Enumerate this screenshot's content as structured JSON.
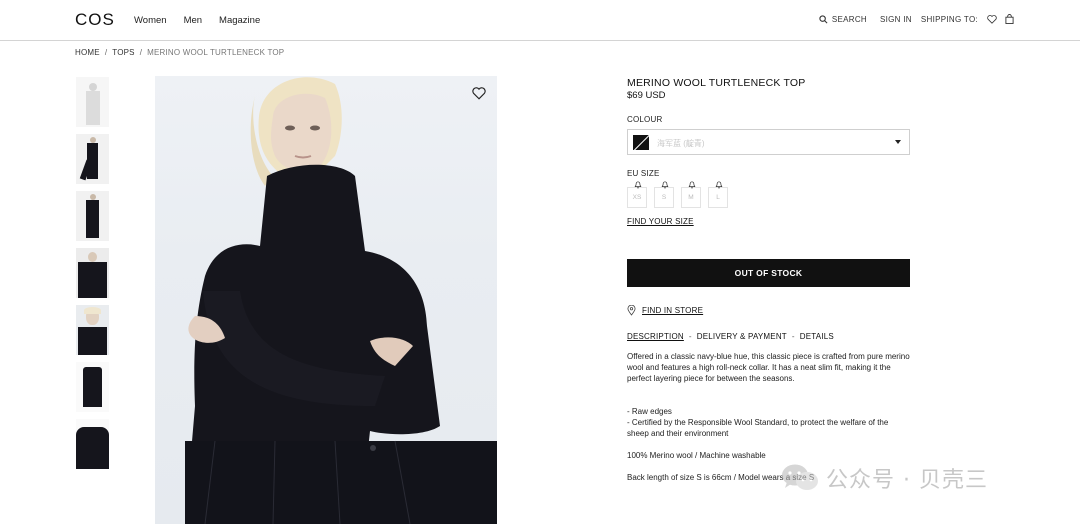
{
  "header": {
    "logo": "COS",
    "nav": [
      "Women",
      "Men",
      "Magazine"
    ],
    "search_label": "SEARCH",
    "signin_label": "SIGN IN",
    "shipping_label": "SHIPPING TO:"
  },
  "breadcrumb": {
    "items": [
      "HOME",
      "TOPS",
      "MERINO WOOL TURTLENECK TOP"
    ],
    "separator": "/"
  },
  "product": {
    "title": "MERINO WOOL TURTLENECK TOP",
    "price": "$69 USD",
    "colour_label": "COLOUR",
    "colour_value": "海军蓝 (靛青)",
    "size_label": "EU SIZE",
    "sizes": [
      "XS",
      "S",
      "M",
      "L"
    ],
    "find_size_label": "FIND YOUR SIZE",
    "cta_label": "OUT OF STOCK",
    "find_store_label": "FIND IN STORE",
    "tabs": [
      "DESCRIPTION",
      "DELIVERY & PAYMENT",
      "DETAILS"
    ],
    "tab_separator": "-",
    "description": "Offered in a classic navy-blue hue, this classic piece is crafted from pure merino wool and features a high roll-neck collar. It has a neat slim fit, making it the perfect layering piece for between the seasons.",
    "bullets": [
      "- Raw edges",
      "- Certified by the Responsible Wool Standard, to protect the welfare of the sheep and their environment"
    ],
    "composition": "100% Merino wool / Machine washable",
    "fit_note": "Back length of size S is 66cm / Model wears a size S"
  },
  "watermark": {
    "text": "公众号 · 贝壳三"
  },
  "colors": {
    "primary": "#111111",
    "garment": "#15151c",
    "image_bg": "#e9edf2"
  }
}
